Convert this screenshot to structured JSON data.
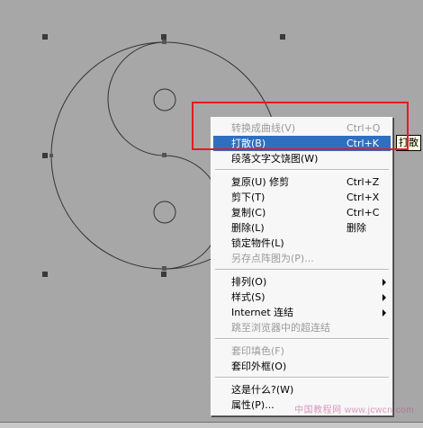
{
  "menu": {
    "items": [
      {
        "label": "转换成曲线(V)",
        "shortcut": "Ctrl+Q",
        "disabled": true
      },
      {
        "label": "打散(B)",
        "shortcut": "Ctrl+K",
        "highlighted": true
      },
      {
        "label": "段落文字文饶图(W)",
        "shortcut": ""
      },
      {
        "label": "复原(U) 修剪",
        "shortcut": "Ctrl+Z"
      },
      {
        "label": "剪下(T)",
        "shortcut": "Ctrl+X"
      },
      {
        "label": "复制(C)",
        "shortcut": "Ctrl+C"
      },
      {
        "label": "删除(L)",
        "shortcut": "删除"
      },
      {
        "label": "锁定物件(L)",
        "shortcut": ""
      },
      {
        "label": "另存点阵图为(P)...",
        "shortcut": "",
        "disabled": true
      },
      {
        "label": "排列(O)",
        "submenu": true
      },
      {
        "label": "样式(S)",
        "submenu": true
      },
      {
        "label": "Internet 连结",
        "submenu": true
      },
      {
        "label": "跳至浏览器中的超连结",
        "disabled": true
      },
      {
        "label": "套印填色(F)",
        "disabled": true
      },
      {
        "label": "套印外框(O)"
      },
      {
        "label": "这是什么?(W)"
      },
      {
        "label": "属性(P)..."
      }
    ]
  },
  "tooltip": {
    "text": "打散"
  },
  "watermark": {
    "text": "中国教程网 www.jcwcn.com"
  },
  "colors": {
    "highlight": "#2f6fc0",
    "annotation": "#e31b23",
    "canvas": "#a7a7a7"
  }
}
